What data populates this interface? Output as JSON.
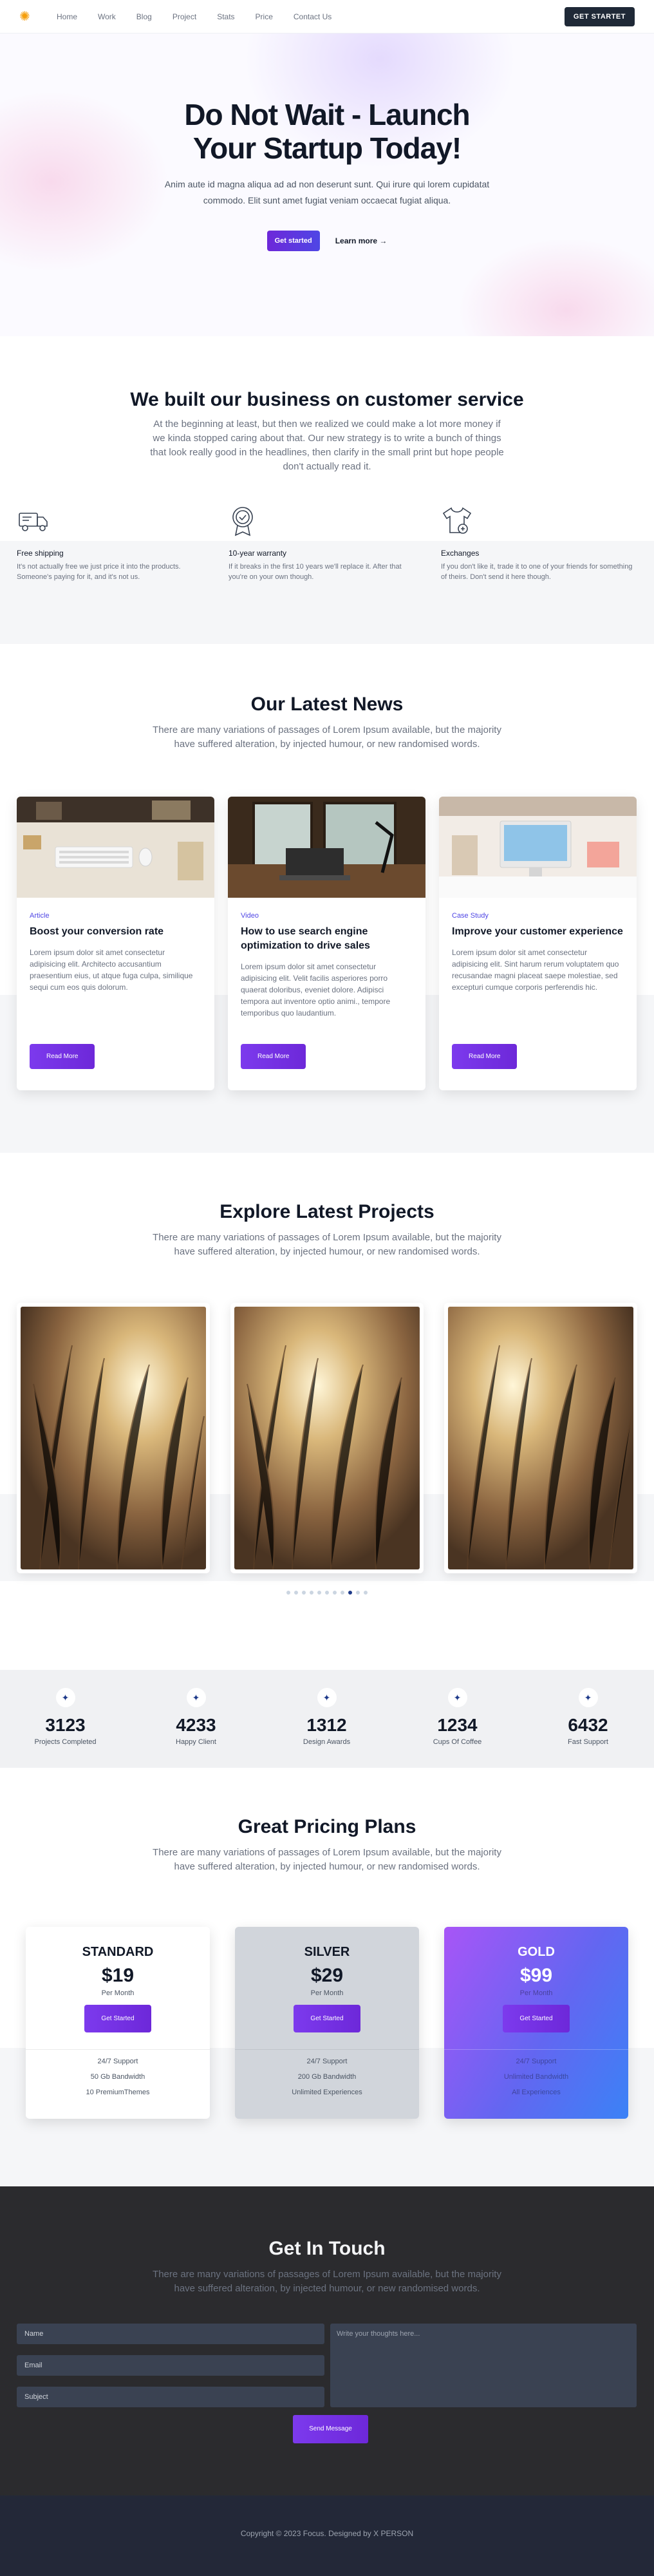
{
  "nav": {
    "items": [
      "Home",
      "Work",
      "Blog",
      "Project",
      "Stats",
      "Price",
      "Contact Us"
    ],
    "cta": "GET STARTET"
  },
  "hero": {
    "title_line1": "Do Not Wait - Launch",
    "title_line2": "Your Startup Today!",
    "subtitle": "Anim aute id magna aliqua ad ad non deserunt sunt. Qui irure qui lorem cupidatat commodo. Elit sunt amet fugiat veniam occaecat fugiat aliqua.",
    "primary_btn": "Get started",
    "secondary_btn": "Learn more →"
  },
  "about": {
    "title": "We built our business on customer service",
    "text": "At the beginning at least, but then we realized we could make a lot more money if we kinda stopped caring about that. Our new strategy is to write a bunch of things that look really good in the headlines, then clarify in the small print but hope people don't actually read it.",
    "features": [
      {
        "icon": "truck-icon",
        "title": "Free shipping",
        "text": "It's not actually free we just price it into the products. Someone's paying for it, and it's not us."
      },
      {
        "icon": "badge-icon",
        "title": "10-year warranty",
        "text": "If it breaks in the first 10 years we'll replace it. After that you're on your own though."
      },
      {
        "icon": "tshirt-icon",
        "title": "Exchanges",
        "text": "If you don't like it, trade it to one of your friends for something of theirs. Don't send it here though."
      }
    ]
  },
  "news": {
    "title": "Our Latest News",
    "subtitle": "There are many variations of passages of Lorem Ipsum available, but the majority have suffered alteration, by injected humour, or new randomised words.",
    "cards": [
      {
        "tag": "Article",
        "title": "Boost your conversion rate",
        "text": "Lorem ipsum dolor sit amet consectetur adipisicing elit. Architecto accusantium praesentium eius, ut atque fuga culpa, similique sequi cum eos quis dolorum.",
        "button": "Read More"
      },
      {
        "tag": "Video",
        "title": "How to use search engine optimization to drive sales",
        "text": "Lorem ipsum dolor sit amet consectetur adipisicing elit. Velit facilis asperiores porro quaerat doloribus, eveniet dolore. Adipisci tempora aut inventore optio animi., tempore temporibus quo laudantium.",
        "button": "Read More"
      },
      {
        "tag": "Case Study",
        "title": "Improve your customer experience",
        "text": "Lorem ipsum dolor sit amet consectetur adipisicing elit. Sint harum rerum voluptatem quo recusandae magni placeat saepe molestiae, sed excepturi cumque corporis perferendis hic.",
        "button": "Read More"
      }
    ]
  },
  "projects": {
    "title": "Explore Latest Projects",
    "subtitle": "There are many variations of passages of Lorem Ipsum available, but the majority have suffered alteration, by injected humour, or new randomised words.",
    "dots_total": 11,
    "dots_active": 8
  },
  "stats": [
    {
      "icon": "sparkle-icon",
      "value": "3123",
      "label": "Projects Completed"
    },
    {
      "icon": "sparkle-icon",
      "value": "4233",
      "label": "Happy Client"
    },
    {
      "icon": "sparkle-icon",
      "value": "1312",
      "label": "Design Awards"
    },
    {
      "icon": "sparkle-icon",
      "value": "1234",
      "label": "Cups Of Coffee"
    },
    {
      "icon": "sparkle-icon",
      "value": "6432",
      "label": "Fast Support"
    }
  ],
  "pricing": {
    "title": "Great Pricing Plans",
    "subtitle": "There are many variations of passages of Lorem Ipsum available, but the majority have suffered alteration, by injected humour, or new randomised words.",
    "plans": [
      {
        "name": "STANDARD",
        "price": "$19",
        "per": "Per Month",
        "button": "Get Started",
        "features": [
          "24/7 Support",
          "50 Gb Bandwidth",
          "10 PremiumThemes"
        ]
      },
      {
        "name": "SILVER",
        "price": "$29",
        "per": "Per Month",
        "button": "Get Started",
        "features": [
          "24/7 Support",
          "200 Gb Bandwidth",
          "Unlimited Experiences"
        ]
      },
      {
        "name": "GOLD",
        "price": "$99",
        "per": "Per Month",
        "button": "Get Started",
        "features": [
          "24/7 Support",
          "Unlimited Bandwidth",
          "All Experiences"
        ]
      }
    ]
  },
  "contact": {
    "title": "Get In Touch",
    "subtitle": "There are many variations of passages of Lorem Ipsum available, but the majority have suffered alteration, by injected humour, or new randomised words.",
    "name_placeholder": "Name",
    "email_placeholder": "Email",
    "subject_placeholder": "Subject",
    "message_placeholder": "Write your thoughts here...",
    "send": "Send Message"
  },
  "footer": {
    "copyright": "Copyright © 2023 Focus. Designed by X PERSON"
  },
  "colors": {
    "accent": "#6d28d9",
    "dark": "#1f2937",
    "contact_bg": "#2b2b2e",
    "footer_bg": "#232838"
  }
}
